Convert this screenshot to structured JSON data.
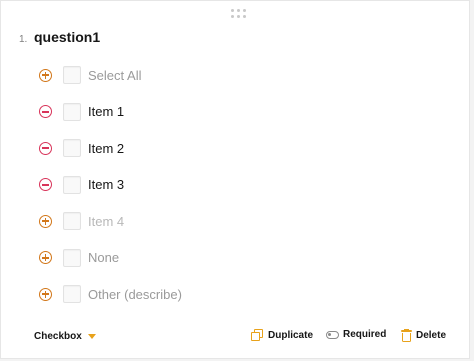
{
  "question": {
    "number": "1.",
    "title": "question1"
  },
  "choices": [
    {
      "label": "Select All",
      "action": "add",
      "checked": false,
      "style": "muted"
    },
    {
      "label": "Item 1",
      "action": "remove",
      "checked": false,
      "style": "normal"
    },
    {
      "label": "Item 2",
      "action": "remove",
      "checked": false,
      "style": "normal"
    },
    {
      "label": "Item 3",
      "action": "remove",
      "checked": false,
      "style": "normal"
    },
    {
      "label": "Item 4",
      "action": "add",
      "checked": false,
      "style": "faint"
    },
    {
      "label": "None",
      "action": "add",
      "checked": false,
      "style": "muted"
    },
    {
      "label": "Other (describe)",
      "action": "add",
      "checked": false,
      "style": "muted"
    }
  ],
  "footer": {
    "question_type": "Checkbox",
    "duplicate_label": "Duplicate",
    "required_label": "Required",
    "delete_label": "Delete"
  },
  "icons": {
    "drag": "drag-handle-icon",
    "add": "plus-circle-icon",
    "remove": "minus-circle-icon",
    "duplicate": "duplicate-icon",
    "required": "toggle-icon",
    "delete": "trash-icon",
    "dropdown": "caret-down-icon"
  },
  "colors": {
    "accent": "#e8a21b",
    "add": "#d2771a",
    "remove": "#d8345a",
    "text": "#161616",
    "muted_text": "#9a9a9a"
  }
}
